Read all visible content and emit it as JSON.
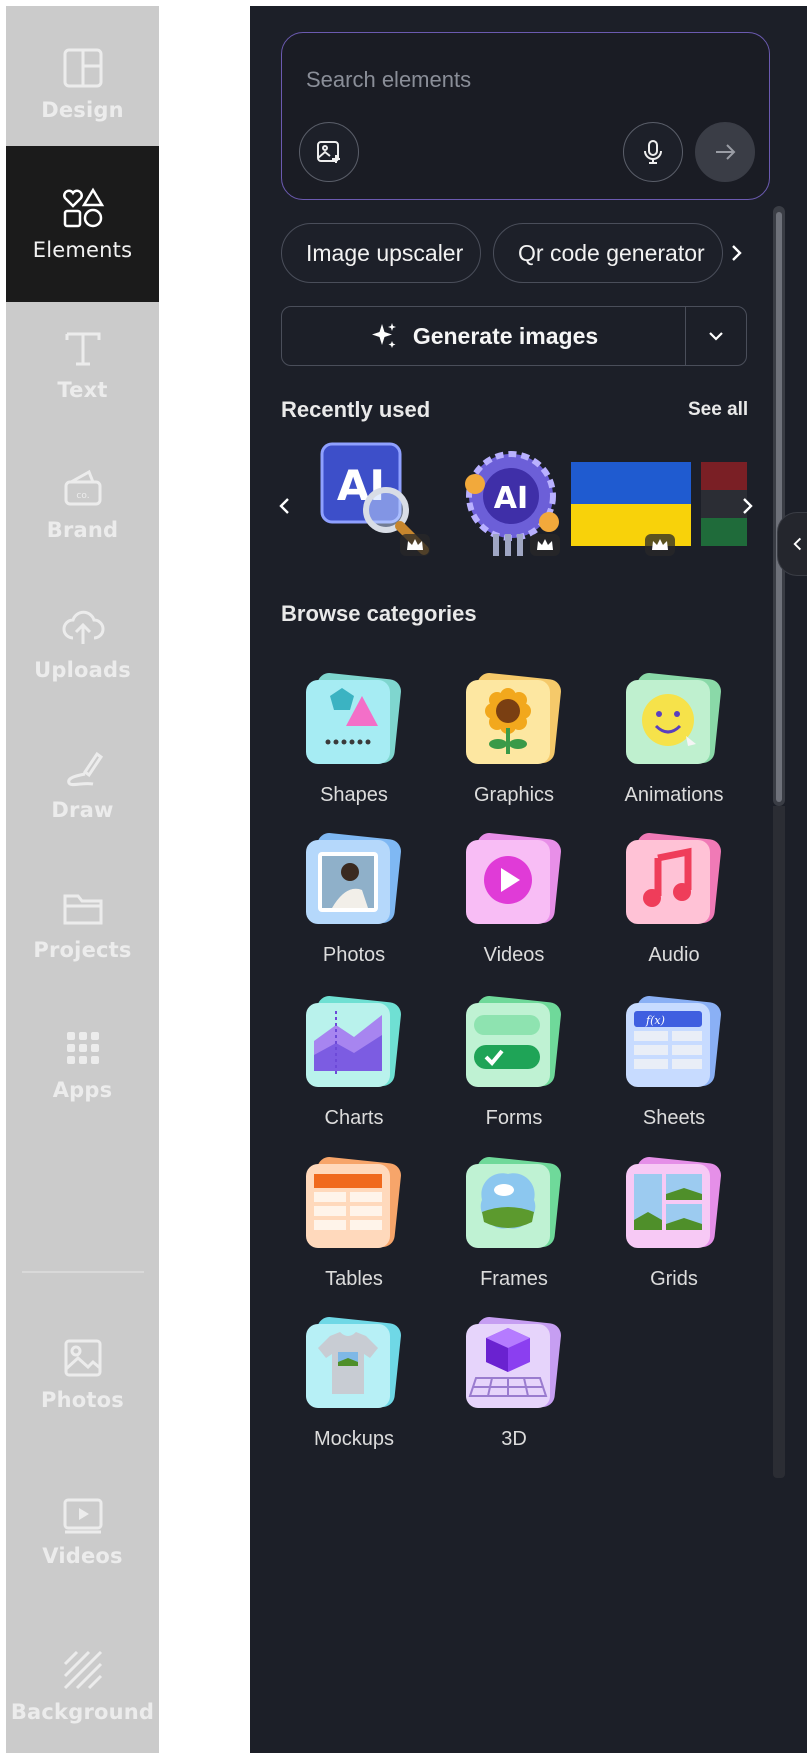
{
  "sidebar": {
    "items": [
      {
        "label": "Design",
        "icon": "layout-icon"
      },
      {
        "label": "Elements",
        "icon": "shapes-icon",
        "active": true
      },
      {
        "label": "Text",
        "icon": "text-icon"
      },
      {
        "label": "Brand",
        "icon": "brand-icon"
      },
      {
        "label": "Uploads",
        "icon": "cloud-upload-icon"
      },
      {
        "label": "Draw",
        "icon": "pen-icon"
      },
      {
        "label": "Projects",
        "icon": "folder-icon"
      },
      {
        "label": "Apps",
        "icon": "grid-dots-icon"
      },
      {
        "label": "Photos",
        "icon": "image-icon"
      },
      {
        "label": "Videos",
        "icon": "video-icon"
      },
      {
        "label": "Background",
        "icon": "hatch-icon"
      }
    ]
  },
  "search": {
    "placeholder": "Search elements",
    "image_button_icon": "image-search-icon",
    "mic_icon": "microphone-icon",
    "send_icon": "arrow-right-icon"
  },
  "chips": [
    "Image upscaler",
    "Qr code generator"
  ],
  "generate": {
    "label": "Generate images",
    "icon": "sparkle-icon"
  },
  "recent": {
    "title": "Recently used",
    "see_all": "See all",
    "items": [
      "AI magnifier sticker",
      "AI gear sticker",
      "Ukraine flag",
      "Red and green flag"
    ]
  },
  "categories": {
    "title": "Browse categories",
    "items": [
      "Shapes",
      "Graphics",
      "Animations",
      "Photos",
      "Videos",
      "Audio",
      "Charts",
      "Forms",
      "Sheets",
      "Tables",
      "Frames",
      "Grids",
      "Mockups",
      "3D"
    ]
  },
  "colors": {
    "panel_bg": "#1c1f28",
    "rail_bg": "#cbcbcb",
    "rail_active": "#1b1b1b",
    "search_border": "#6b5ab0"
  }
}
